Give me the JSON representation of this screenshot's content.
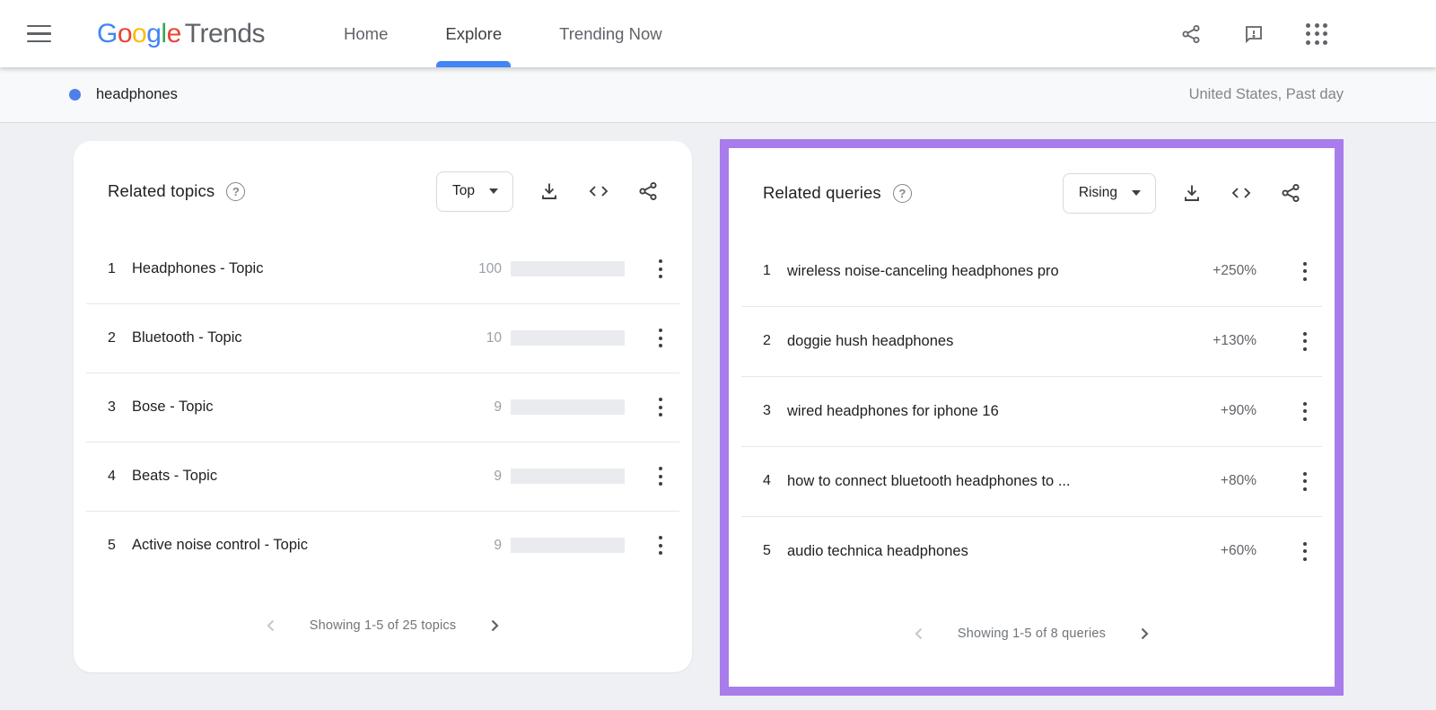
{
  "navbar": {
    "logo": {
      "letters": [
        {
          "ch": "G",
          "color": "#4285F4"
        },
        {
          "ch": "o",
          "color": "#EA4335"
        },
        {
          "ch": "o",
          "color": "#FBBC05"
        },
        {
          "ch": "g",
          "color": "#4285F4"
        },
        {
          "ch": "l",
          "color": "#34A853"
        },
        {
          "ch": "e",
          "color": "#EA4335"
        }
      ],
      "suffix": "Trends"
    },
    "tabs": [
      {
        "label": "Home",
        "active": false
      },
      {
        "label": "Explore",
        "active": true
      },
      {
        "label": "Trending Now",
        "active": false
      }
    ],
    "action_icons": [
      "share-icon",
      "feedback-icon",
      "apps-grid-icon"
    ]
  },
  "subheader": {
    "term": "headphones",
    "scope": "United States, Past day"
  },
  "topics_card": {
    "title": "Related topics",
    "help_icon": "?",
    "dropdown_value": "Top",
    "tool_icons": [
      "download-icon",
      "embed-code-icon",
      "share-icon"
    ],
    "items": [
      {
        "rank": 1,
        "label": "Headphones - Topic",
        "value": 100
      },
      {
        "rank": 2,
        "label": "Bluetooth - Topic",
        "value": 10
      },
      {
        "rank": 3,
        "label": "Bose - Topic",
        "value": 9
      },
      {
        "rank": 4,
        "label": "Beats - Topic",
        "value": 9
      },
      {
        "rank": 5,
        "label": "Active noise control - Topic",
        "value": 9
      }
    ],
    "pagination": "Showing 1-5 of 25 topics"
  },
  "queries_card": {
    "title": "Related queries",
    "help_icon": "?",
    "dropdown_value": "Rising",
    "tool_icons": [
      "download-icon",
      "embed-code-icon",
      "share-icon"
    ],
    "items": [
      {
        "rank": 1,
        "label": "wireless noise-canceling headphones pro",
        "change": "+250%"
      },
      {
        "rank": 2,
        "label": "doggie hush headphones",
        "change": "+130%"
      },
      {
        "rank": 3,
        "label": "wired headphones for iphone 16",
        "change": "+90%"
      },
      {
        "rank": 4,
        "label": "how to connect bluetooth headphones to ...",
        "change": "+80%"
      },
      {
        "rank": 5,
        "label": "audio technica headphones",
        "change": "+60%"
      }
    ],
    "pagination": "Showing 1-5 of 8 queries"
  },
  "colors": {
    "accent_blue": "#4285F4",
    "bar_fill": "#5381E8",
    "bar_track": "#E9EBEE",
    "term_dot": "#4F80E8",
    "highlight_purple": "#A87CEB"
  }
}
